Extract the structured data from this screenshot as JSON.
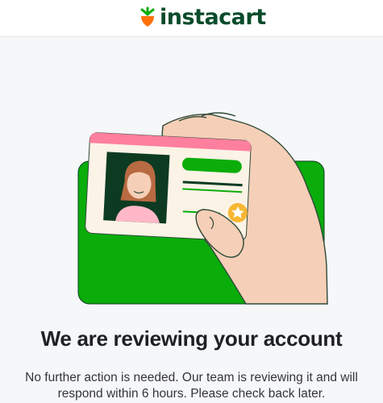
{
  "brand": {
    "name": "instacart",
    "logo_icon": "carrot-icon",
    "text_color": "#0a4c2b",
    "leaf_color": "#0aad0a",
    "carrot_color": "#ff7009"
  },
  "illustration": {
    "icon": "id-card-in-hand-illustration",
    "card_background": "#0aad0a"
  },
  "main": {
    "title": "We are reviewing your account",
    "message": "No further action is needed. Our team is reviewing it and will respond within 6 hours. Please check back later."
  }
}
